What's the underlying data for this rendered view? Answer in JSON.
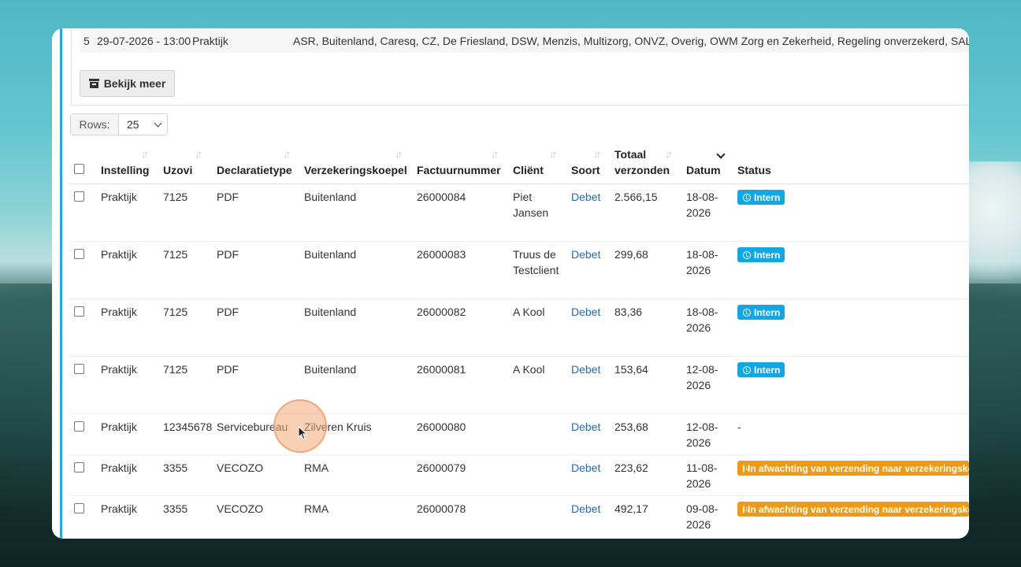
{
  "previous_row": {
    "index": "5",
    "datetime": "29-07-2026 - 13:00",
    "instelling": "Praktijk",
    "verzekeraars": "ASR, Buitenland, Caresq, CZ, De Friesland, DSW, Menzis, Multizorg, ONVZ, Overig, OWM Zorg en Zekerheid, Regeling onverzekerd, SALLAND, VGZ,"
  },
  "bekijk_meer_label": "Bekijk meer",
  "rows_control": {
    "label": "Rows:",
    "value": "25"
  },
  "columns": {
    "instelling": "Instelling",
    "uzovi": "Uzovi",
    "declaratietype": "Declaratietype",
    "verzekeringskoepel": "Verzekeringskoepel",
    "factuurnummer": "Factuurnummer",
    "client": "Cliënt",
    "soort": "Soort",
    "totaal_1": "Totaal",
    "totaal_2": "verzonden",
    "datum": "Datum",
    "status": "Status"
  },
  "rows": [
    {
      "instelling": "Praktijk",
      "uzovi": "7125",
      "type": "PDF",
      "koepel": "Buitenland",
      "factuur": "26000084",
      "client_1": "Piet",
      "client_2": "Jansen",
      "soort": "Debet",
      "totaal": "2.566,15",
      "datum_1": "18-08-",
      "datum_2": "2026",
      "status": "Intern"
    },
    {
      "instelling": "Praktijk",
      "uzovi": "7125",
      "type": "PDF",
      "koepel": "Buitenland",
      "factuur": "26000083",
      "client_1": "Truus de",
      "client_2": "Testclient",
      "soort": "Debet",
      "totaal": "299,68",
      "datum_1": "18-08-",
      "datum_2": "2026",
      "status": "Intern"
    },
    {
      "instelling": "Praktijk",
      "uzovi": "7125",
      "type": "PDF",
      "koepel": "Buitenland",
      "factuur": "26000082",
      "client_1": "A Kool",
      "client_2": "",
      "soort": "Debet",
      "totaal": "83,36",
      "datum_1": "18-08-",
      "datum_2": "2026",
      "status": "Intern"
    },
    {
      "instelling": "Praktijk",
      "uzovi": "7125",
      "type": "PDF",
      "koepel": "Buitenland",
      "factuur": "26000081",
      "client_1": "A Kool",
      "client_2": "",
      "soort": "Debet",
      "totaal": "153,64",
      "datum_1": "12-08-",
      "datum_2": "2026",
      "status": "Intern"
    },
    {
      "instelling": "Praktijk",
      "uzovi": "12345678",
      "type": "Servicebureau",
      "koepel": "Zilveren Kruis",
      "factuur": "26000080",
      "client_1": "",
      "client_2": "",
      "soort": "Debet",
      "totaal": "253,68",
      "datum_1": "12-08-",
      "datum_2": "2026",
      "status": "-"
    },
    {
      "instelling": "Praktijk",
      "uzovi": "3355",
      "type": "VECOZO",
      "koepel": "RMA",
      "factuur": "26000079",
      "client_1": "",
      "client_2": "",
      "soort": "Debet",
      "totaal": "223,62",
      "datum_1": "11-08-",
      "datum_2": "2026",
      "status": "In afwachting van verzending naar verzekeringskoep"
    },
    {
      "instelling": "Praktijk",
      "uzovi": "3355",
      "type": "VECOZO",
      "koepel": "RMA",
      "factuur": "26000078",
      "client_1": "",
      "client_2": "",
      "soort": "Debet",
      "totaal": "492,17",
      "datum_1": "09-08-",
      "datum_2": "2026",
      "status": "In afwachting van verzending naar verzekeringskoep"
    }
  ],
  "colors": {
    "accent": "#2aa6d9",
    "intern_badge": "#12a7e1",
    "waiting_badge": "#ef9a16",
    "link": "#2c6aa0"
  }
}
